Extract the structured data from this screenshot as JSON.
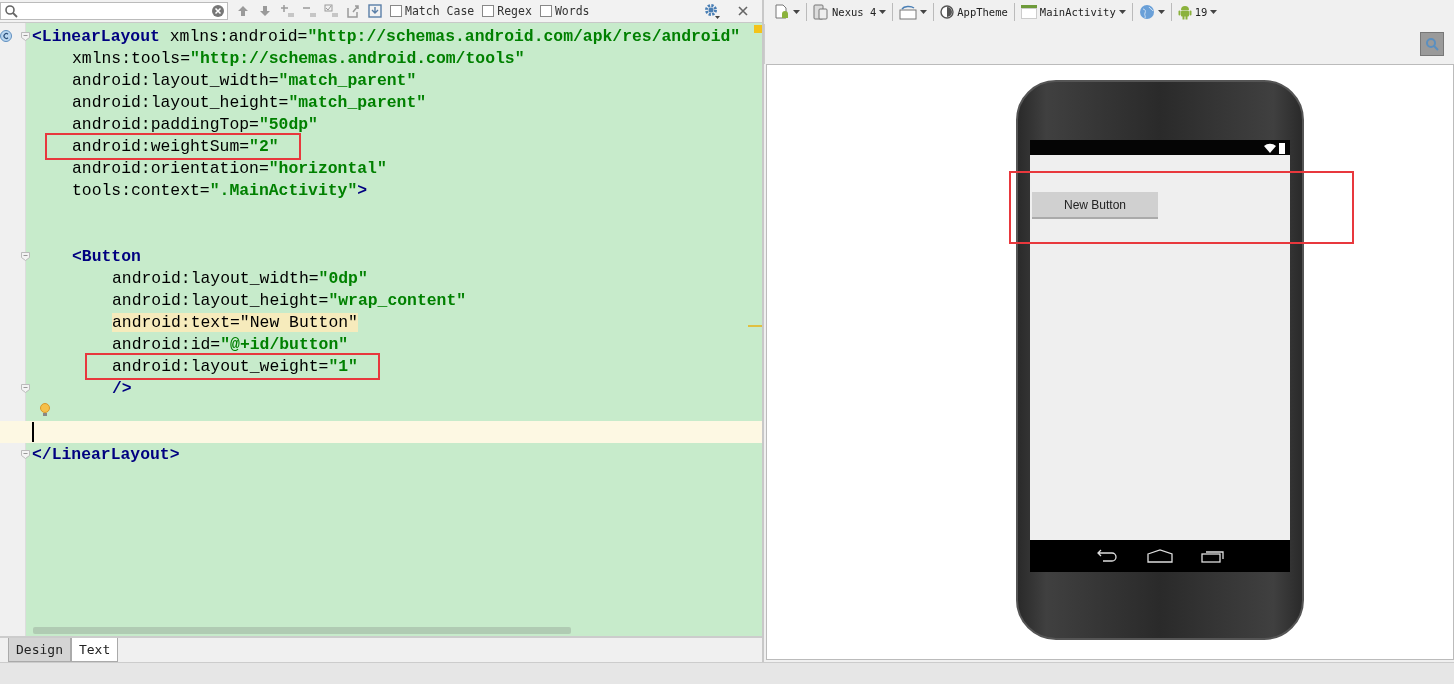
{
  "find_bar": {
    "options": [
      {
        "label": "Match Case",
        "checked": false
      },
      {
        "label": "Regex",
        "checked": false
      },
      {
        "label": "Words",
        "checked": false
      }
    ]
  },
  "editor": {
    "lines": [
      {
        "kind": "code",
        "fold": true,
        "segments": [
          {
            "kind": "tag",
            "text": "<LinearLayout"
          },
          {
            "kind": "attr",
            "text": " xmlns:android="
          },
          {
            "kind": "value",
            "text": "\"http://schemas.android.com/apk/res/android\""
          }
        ],
        "children": [
          {
            "kind": "code",
            "segments": [
              {
                "kind": "attr",
                "text": "xmlns:tools="
              },
              {
                "kind": "value",
                "text": "\"http://schemas.android.com/tools\""
              }
            ]
          },
          {
            "kind": "code",
            "segments": [
              {
                "kind": "attr",
                "text": "android:layout_width="
              },
              {
                "kind": "value",
                "text": "\"match_parent\""
              }
            ]
          },
          {
            "kind": "code",
            "segments": [
              {
                "kind": "attr",
                "text": "android:layout_height="
              },
              {
                "kind": "value",
                "text": "\"match_parent\""
              }
            ]
          },
          {
            "kind": "code",
            "segments": [
              {
                "kind": "attr",
                "text": "android:paddingTop="
              },
              {
                "kind": "value",
                "text": "\"50dp\""
              }
            ]
          },
          {
            "kind": "code",
            "boxed": true,
            "segments": [
              {
                "kind": "attr",
                "text": "android:weightSum="
              },
              {
                "kind": "value",
                "text": "\"2\""
              }
            ]
          },
          {
            "kind": "code",
            "segments": [
              {
                "kind": "attr",
                "text": "android:orientation="
              },
              {
                "kind": "value",
                "text": "\"horizontal\""
              }
            ]
          },
          {
            "kind": "code",
            "segments": [
              {
                "kind": "attr",
                "text": "tools:context="
              },
              {
                "kind": "value",
                "text": "\".MainActivity\""
              },
              {
                "kind": "tag",
                "text": ">"
              }
            ]
          },
          {
            "kind": "blank"
          },
          {
            "kind": "blank"
          },
          {
            "kind": "code",
            "fold": true,
            "segments": [
              {
                "kind": "tag",
                "text": "<Button"
              }
            ],
            "children": [
              {
                "kind": "code",
                "segments": [
                  {
                    "kind": "attr",
                    "text": "android:layout_width="
                  },
                  {
                    "kind": "value",
                    "text": "\"0dp\""
                  }
                ]
              },
              {
                "kind": "code",
                "segments": [
                  {
                    "kind": "attr",
                    "text": "android:layout_height="
                  },
                  {
                    "kind": "value",
                    "text": "\"wrap_content\""
                  }
                ]
              },
              {
                "kind": "code",
                "segments": [
                  {
                    "kind": "hl",
                    "text": "android:text=\"New Button\""
                  }
                ]
              },
              {
                "kind": "code",
                "segments": [
                  {
                    "kind": "attr",
                    "text": "android:id="
                  },
                  {
                    "kind": "value",
                    "text": "\"@+id/button\""
                  }
                ]
              },
              {
                "kind": "code",
                "boxed": true,
                "segments": [
                  {
                    "kind": "attr",
                    "text": "android:layout_weight="
                  },
                  {
                    "kind": "value",
                    "text": "\"1\""
                  }
                ]
              },
              {
                "kind": "code",
                "fold": true,
                "segments": [
                  {
                    "kind": "tag",
                    "text": "/>"
                  }
                ]
              }
            ]
          }
        ]
      },
      {
        "kind": "blank",
        "bulb": true
      },
      {
        "kind": "blank",
        "current": true
      },
      {
        "kind": "code",
        "fold": true,
        "segments": [
          {
            "kind": "tag",
            "text": "</LinearLayout>"
          }
        ]
      }
    ]
  },
  "editor_tabs": [
    {
      "label": "Design",
      "selected": false
    },
    {
      "label": "Text",
      "selected": true
    }
  ],
  "preview_toolbar": {
    "device": "Nexus 4",
    "theme": "AppTheme",
    "activity": "MainActivity",
    "api": "19"
  },
  "preview": {
    "button_label": "New Button",
    "highlighted": true
  }
}
